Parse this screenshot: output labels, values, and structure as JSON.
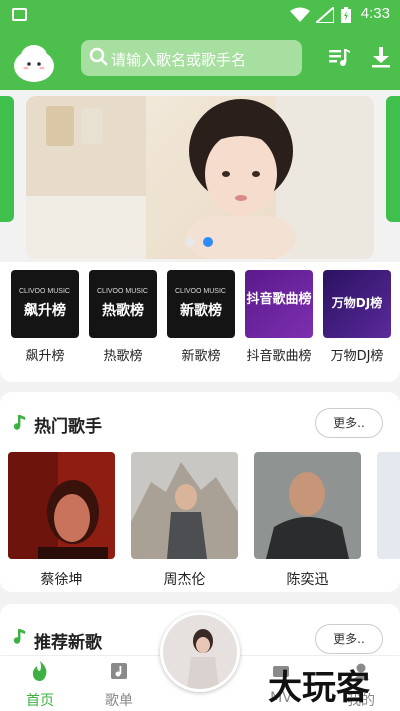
{
  "status_bar": {
    "time": "4:33"
  },
  "header": {
    "search": {
      "placeholder": "请输入歌名或歌手名"
    }
  },
  "banner": {
    "page_count": 2,
    "active_index": 1
  },
  "charts": [
    {
      "label": "飙升榜",
      "cover_title": "飙升榜",
      "brand": "CLIVOO MUSIC"
    },
    {
      "label": "热歌榜",
      "cover_title": "热歌榜",
      "brand": "CLIVOO MUSIC"
    },
    {
      "label": "新歌榜",
      "cover_title": "新歌榜",
      "brand": "CLIVOO MUSIC"
    },
    {
      "label": "抖音歌曲榜",
      "cover_title": "抖音歌曲榜",
      "brand": ""
    },
    {
      "label": "万物DJ榜",
      "cover_title": "万物DJ榜",
      "brand": ""
    }
  ],
  "hot_singers": {
    "title": "热门歌手",
    "more_label": "更多..",
    "items": [
      {
        "name": "蔡徐坤"
      },
      {
        "name": "周杰伦"
      },
      {
        "name": "陈奕迅"
      }
    ]
  },
  "new_songs": {
    "title": "推荐新歌",
    "more_label": "更多.."
  },
  "bottom_nav": {
    "items": [
      {
        "label": "首页",
        "active": true
      },
      {
        "label": "歌单",
        "active": false
      },
      {
        "label": "MV",
        "active": false
      },
      {
        "label": "我的",
        "active": false
      }
    ]
  },
  "watermark": "大玩客",
  "colors": {
    "brand_green": "#4dbf4d",
    "active_dot": "#2f8cff"
  }
}
